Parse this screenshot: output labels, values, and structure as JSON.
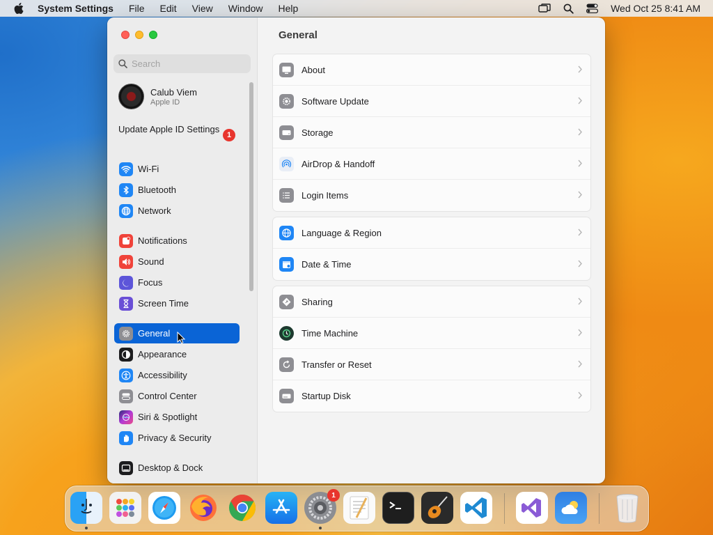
{
  "menubar": {
    "app_name": "System Settings",
    "menus": [
      "File",
      "Edit",
      "View",
      "Window",
      "Help"
    ],
    "clock": "Wed Oct 25  8:41 AM"
  },
  "sidebar": {
    "search_placeholder": "Search",
    "profile": {
      "name": "Calub Viem",
      "subtitle": "Apple ID"
    },
    "update": {
      "label": "Update Apple ID Settings",
      "badge": "1"
    },
    "items": [
      {
        "label": "Wi-Fi",
        "icon": "wifi-icon",
        "color": "#1f86f5"
      },
      {
        "label": "Bluetooth",
        "icon": "bluetooth-icon",
        "color": "#1f86f5"
      },
      {
        "label": "Network",
        "icon": "globe-icon",
        "color": "#1f86f5"
      },
      {
        "label": "Notifications",
        "icon": "bell-icon",
        "color": "#f0433a"
      },
      {
        "label": "Sound",
        "icon": "speaker-icon",
        "color": "#f0433a"
      },
      {
        "label": "Focus",
        "icon": "moon-icon",
        "color": "#5d55d9"
      },
      {
        "label": "Screen Time",
        "icon": "hourglass-icon",
        "color": "#6a4fd6"
      },
      {
        "label": "General",
        "icon": "gear-icon",
        "color": "#8e8e93"
      },
      {
        "label": "Appearance",
        "icon": "appearance-icon",
        "color": "#1c1c1e"
      },
      {
        "label": "Accessibility",
        "icon": "accessibility-icon",
        "color": "#1f86f5"
      },
      {
        "label": "Control Center",
        "icon": "control-center-icon",
        "color": "#8e8e93"
      },
      {
        "label": "Siri & Spotlight",
        "icon": "siri-icon",
        "color": "#b13ad6"
      },
      {
        "label": "Privacy & Security",
        "icon": "hand-icon",
        "color": "#1f86f5"
      },
      {
        "label": "Desktop & Dock",
        "icon": "dock-icon",
        "color": "#1c1c1e"
      }
    ],
    "selected": "General"
  },
  "main": {
    "title": "General",
    "groups": [
      [
        {
          "label": "About",
          "icon": "computer-icon"
        },
        {
          "label": "Software Update",
          "icon": "gear-badge-icon"
        },
        {
          "label": "Storage",
          "icon": "drive-icon"
        },
        {
          "label": "AirDrop & Handoff",
          "icon": "airdrop-icon"
        },
        {
          "label": "Login Items",
          "icon": "list-icon"
        }
      ],
      [
        {
          "label": "Language & Region",
          "icon": "globe-icon"
        },
        {
          "label": "Date & Time",
          "icon": "calendar-icon"
        }
      ],
      [
        {
          "label": "Sharing",
          "icon": "sharing-icon"
        },
        {
          "label": "Time Machine",
          "icon": "time-machine-icon"
        },
        {
          "label": "Transfer or Reset",
          "icon": "reset-icon"
        },
        {
          "label": "Startup Disk",
          "icon": "disk-icon"
        }
      ]
    ]
  },
  "dock": {
    "apps": [
      "Finder",
      "Launchpad",
      "Safari",
      "Firefox",
      "Chrome",
      "App Store",
      "System Settings",
      "TextEdit",
      "Terminal",
      "GarageBand",
      "Visual Studio Code",
      "Visual Studio",
      "Weather",
      "Trash"
    ],
    "settings_badge": "1"
  }
}
